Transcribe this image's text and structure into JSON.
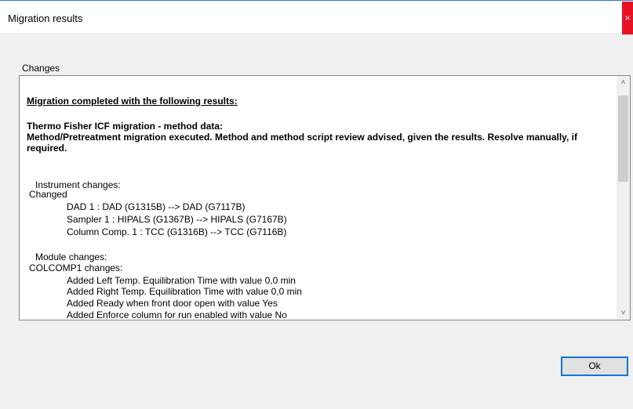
{
  "window": {
    "title": "Migration results",
    "close_glyph": "×"
  },
  "group": {
    "label": "Changes"
  },
  "results": {
    "heading": "Migration completed with the following results:",
    "section_title": "Thermo Fisher ICF migration - method data:",
    "summary": "Method/Pretreatment migration executed. Method and method script review advised, given the results. Resolve manually, if required.",
    "instrument_changes_label": "Instrument changes:",
    "changed_label": "Changed",
    "instrument_items": [
      "DAD 1 : DAD (G1315B) --> DAD (G7117B)",
      "Sampler 1 : HIPALS (G1367B) --> HIPALS (G7167B)",
      "Column Comp. 1 : TCC (G1316B) --> TCC (G7116B)"
    ],
    "module_changes_label": "Module changes:",
    "module_name": "COLCOMP1 changes:",
    "module_items": [
      "Added Left Temp. Equilibration Time with value 0,0 min",
      "Added Right Temp. Equilibration Time with value 0,0 min",
      "Added Ready when front door open with value Yes",
      "Added Enforce column for run enabled with value No"
    ]
  },
  "scrollbar": {
    "up_glyph": "˄",
    "down_glyph": "˅"
  },
  "buttons": {
    "ok_label": "Ok"
  }
}
